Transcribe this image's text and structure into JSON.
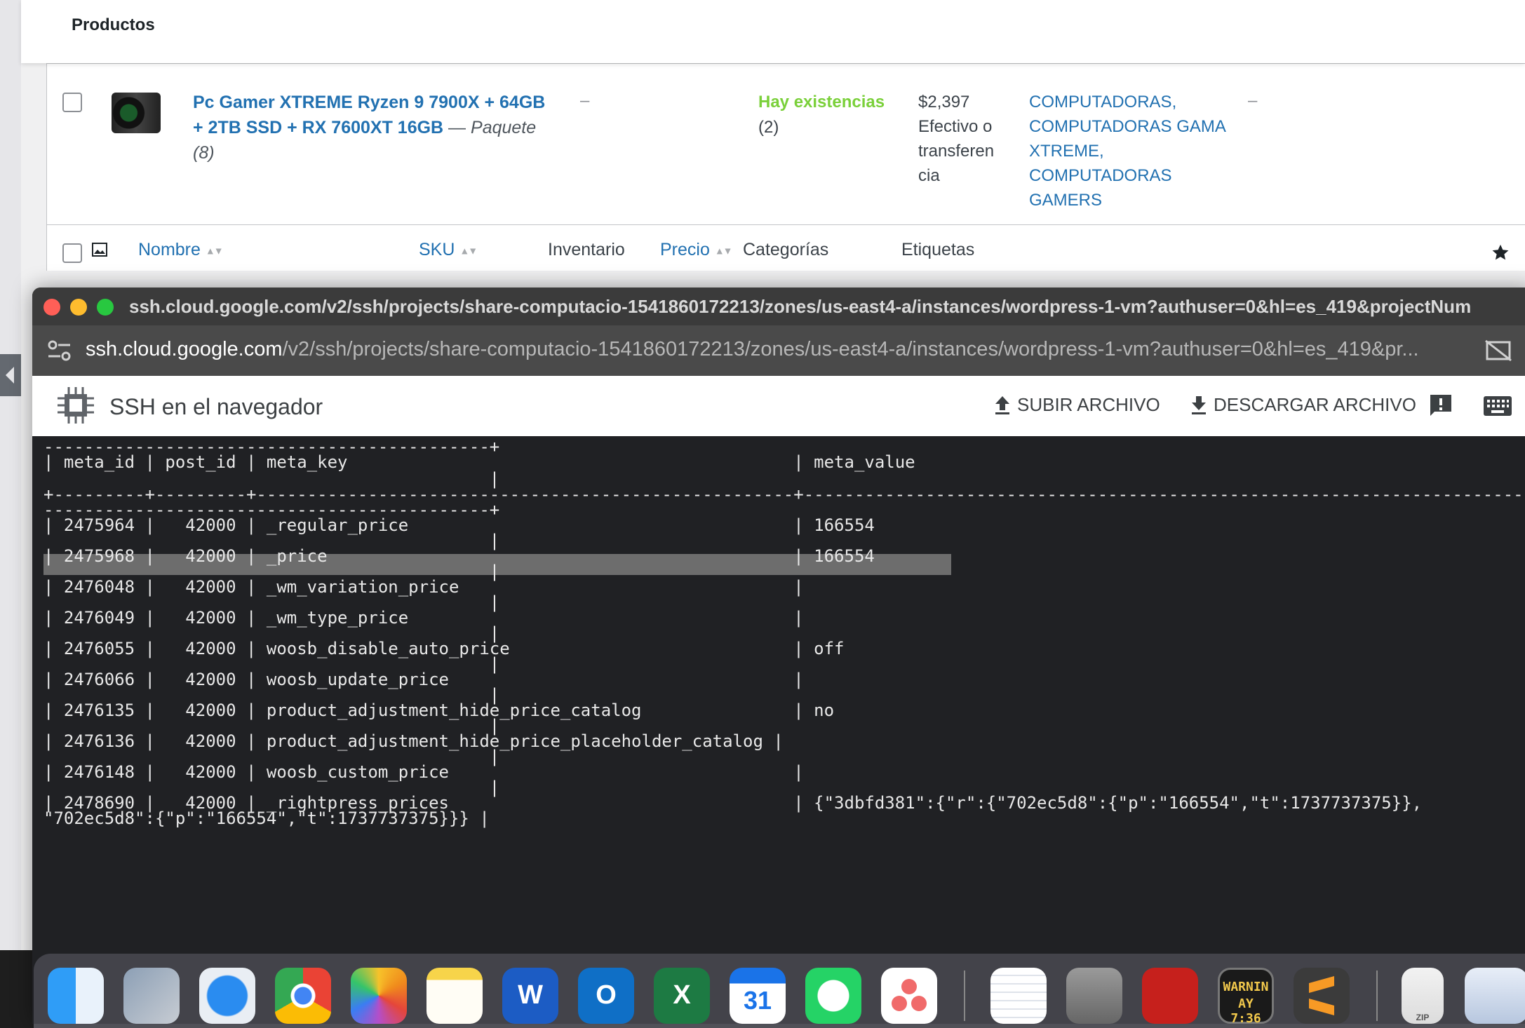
{
  "wp": {
    "page_title": "Productos",
    "product": {
      "name": "Pc Gamer XTREME Ryzen 9 7900X + 64GB + 2TB SSD + RX 7600XT 16GB",
      "type_sep": " — ",
      "type": "Paquete",
      "type_count": "(8)",
      "sku": "–",
      "stock_label": "Hay existencias",
      "stock_count": "(2)",
      "price_lines": [
        "$2,397",
        "Efectivo o",
        "transferen",
        "cia"
      ],
      "categories": [
        "COMPUTADORAS,",
        "COMPUTADORAS GAMA",
        "XTREME,",
        "COMPUTADORAS",
        "GAMERS"
      ],
      "tags": "–"
    },
    "columns": {
      "name": "Nombre",
      "sku": "SKU",
      "stock": "Inventario",
      "price": "Precio",
      "categories": "Categorías",
      "tags": "Etiquetas"
    }
  },
  "browser": {
    "title_url": "ssh.cloud.google.com/v2/ssh/projects/share-computacio-1541860172213/zones/us-east4-a/instances/wordpress-1-vm?authuser=0&hl=es_419&projectNum",
    "address_host": "ssh.cloud.google.com",
    "address_path": "/v2/ssh/projects/share-computacio-1541860172213/zones/us-east4-a/instances/wordpress-1-vm?authuser=0&hl=es_419&pr..."
  },
  "ssh": {
    "title": "SSH en el navegador",
    "upload_label": "SUBIR ARCHIVO",
    "download_label": "DESCARGAR ARCHIVO"
  },
  "terminal": {
    "lines": [
      "--------------------------------------------+",
      "| meta_id | post_id | meta_key                                            | meta_value",
      "                                            |",
      "+---------+---------+-----------------------------------------------------+----------------------------------------------------------------------------------",
      "--------------------------------------------+",
      "| 2475964 |   42000 | _regular_price                                      | 166554",
      "                                            |",
      "| 2475968 |   42000 | _price                                              | 166554",
      "                                            |",
      "| 2476048 |   42000 | _wm_variation_price                                 |",
      "                                            |",
      "| 2476049 |   42000 | _wm_type_price                                      |",
      "                                            |",
      "| 2476055 |   42000 | woosb_disable_auto_price                            | off",
      "                                            |",
      "| 2476066 |   42000 | woosb_update_price                                  |",
      "                                            |",
      "| 2476135 |   42000 | product_adjustment_hide_price_catalog               | no",
      "                                            |",
      "| 2476136 |   42000 | product_adjustment_hide_price_placeholder_catalog |",
      "                                            |",
      "| 2476148 |   42000 | woosb_custom_price                                  |",
      "                                            |",
      "| 2478690 |   42000 | _rightpress_prices                                  | {\"3dbfd381\":{\"r\":{\"702ec5d8\":{\"p\":\"166554\",\"t\":1737737375}},",
      "\"702ec5d8\":{\"p\":\"166554\",\"t\":1737737375}}} |"
    ]
  },
  "dock": {
    "calendar_day": "31",
    "console_line1": "WARNIN",
    "console_line2": "AY 7:36",
    "zip_label": "ZIP"
  },
  "icons": {
    "star": "star-icon",
    "upload": "upload-icon",
    "download": "download-icon",
    "feedback": "feedback-icon",
    "keyboard": "keyboard-icon"
  },
  "colors": {
    "wp_link": "#2271b1",
    "in_stock": "#7ad03a",
    "terminal_bg": "#202124",
    "terminal_highlight": "#6d6d6d"
  }
}
